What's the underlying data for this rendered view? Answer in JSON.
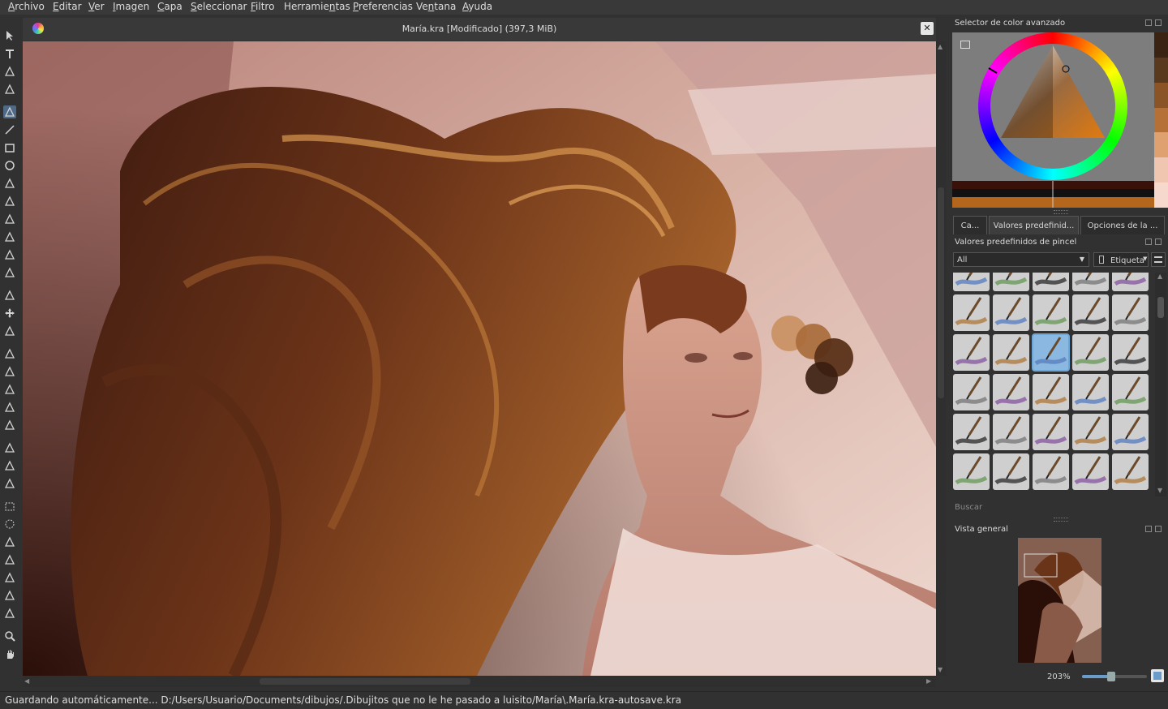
{
  "menu": [
    {
      "pre": "",
      "u": "A",
      "post": "rchivo"
    },
    {
      "pre": "",
      "u": "E",
      "post": "ditar"
    },
    {
      "pre": "",
      "u": "V",
      "post": "er"
    },
    {
      "pre": "",
      "u": "I",
      "post": "magen"
    },
    {
      "pre": "",
      "u": "C",
      "post": "apa"
    },
    {
      "pre": "",
      "u": "S",
      "post": "eleccionar"
    },
    {
      "pre": "",
      "u": "F",
      "post": "iltro"
    },
    {
      "pre": "Herramie",
      "u": "n",
      "post": "tas"
    },
    {
      "pre": "",
      "u": "P",
      "post": "referencias"
    },
    {
      "pre": "Ve",
      "u": "n",
      "post": "tana"
    },
    {
      "pre": "",
      "u": "A",
      "post": "yuda"
    }
  ],
  "document": {
    "title": "María.kra [Modificado]  (397,3 MiB)",
    "close_icon": "close-icon"
  },
  "toolbox": {
    "icons": [
      "select-shapes-icon",
      "text-icon",
      "edit-shapes-icon",
      "calligraphy-icon",
      "freehand-brush-icon",
      "line-icon",
      "rectangle-icon",
      "ellipse-icon",
      "polygon-icon",
      "polyline-icon",
      "bezier-curve-icon",
      "freehand-path-icon",
      "dynamic-brush-icon",
      "multibrush-icon",
      "transform-icon",
      "move-icon",
      "crop-icon",
      "gradient-icon",
      "color-picker-icon",
      "colorize-mask-icon",
      "smart-patch-icon",
      "fill-icon",
      "assistant-icon",
      "measure-icon",
      "reference-images-icon",
      "rect-select-icon",
      "ellipse-select-icon",
      "polygon-select-icon",
      "freehand-select-icon",
      "contiguous-select-icon",
      "similar-select-icon",
      "bezier-select-icon",
      "zoom-icon",
      "pan-icon"
    ],
    "active": "freehand-brush-icon"
  },
  "color_selector": {
    "title": "Selector de color avanzado",
    "swatches": [
      "#3a2312",
      "#5a3a1e",
      "#8a5426",
      "#b57038",
      "#e0a170",
      "#f0c6b0",
      "#f6d8cd"
    ]
  },
  "tabs": [
    {
      "label": "Ca..."
    },
    {
      "label": "Valores predefinid..."
    },
    {
      "label": "Opciones de la ..."
    }
  ],
  "brush_presets": {
    "title": "Valores predefinidos de pincel",
    "filter_value": "All",
    "tag_label": "Etiqueta",
    "search_placeholder": "Buscar"
  },
  "overview": {
    "title": "Vista general",
    "zoom": "203%",
    "zoom_fraction": 0.45
  },
  "status": {
    "text": "Guardando automáticamente... D:/Users/Usuario/Documents/dibujos/.Dibujitos que no le he pasado a luisito/María\\.María.kra-autosave.kra"
  }
}
